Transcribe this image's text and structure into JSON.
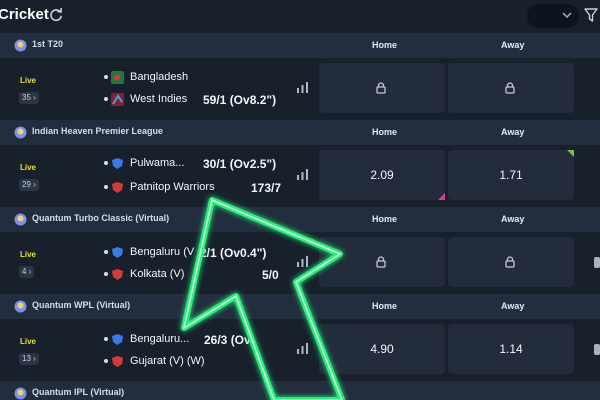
{
  "header": {
    "title": "Cricket"
  },
  "sections": [
    {
      "league": "1st T20",
      "home_label": "Home",
      "away_label": "Away",
      "match": {
        "live_label": "Live",
        "market_count": "35",
        "team1": "Bangladesh",
        "team1_score": "",
        "team2": "West Indies",
        "team2_score": "59/1 (Ov8.2\")",
        "home_odds": "",
        "away_odds": "",
        "home_locked": true,
        "away_locked": true
      }
    },
    {
      "league": "Indian Heaven Premier League",
      "home_label": "Home",
      "away_label": "Away",
      "match": {
        "live_label": "Live",
        "market_count": "29",
        "team1": "Pulwama...",
        "team1_score": "30/1 (Ov2.5\")",
        "team2": "Patnitop Warriors",
        "team2_score": "173/7",
        "home_odds": "2.09",
        "away_odds": "1.71",
        "home_locked": false,
        "away_locked": false
      }
    },
    {
      "league": "Quantum Turbo Classic (Virtual)",
      "home_label": "Home",
      "away_label": "Away",
      "match": {
        "live_label": "Live",
        "market_count": "4",
        "team1": "Bengaluru (V",
        "team1_score": "2/1 (Ov0.4\")",
        "team2": "Kolkata (V)",
        "team2_score": "5/0",
        "home_odds": "",
        "away_odds": "",
        "home_locked": true,
        "away_locked": true
      }
    },
    {
      "league": "Quantum WPL (Virtual)",
      "home_label": "Home",
      "away_label": "Away",
      "match": {
        "live_label": "Live",
        "market_count": "13",
        "team1": "Bengaluru...",
        "team1_score": "26/3 (Ov",
        "team2": "Gujarat (V) (W)",
        "team2_score": "",
        "home_odds": "4.90",
        "away_odds": "1.14",
        "home_locked": false,
        "away_locked": false
      }
    },
    {
      "league": "Quantum IPL (Virtual)"
    }
  ],
  "colors": {
    "live": "#e9e22b",
    "odd_up": "#7bc043",
    "odd_down": "#d53a9d",
    "annotation_arrow": "#27f07a"
  }
}
